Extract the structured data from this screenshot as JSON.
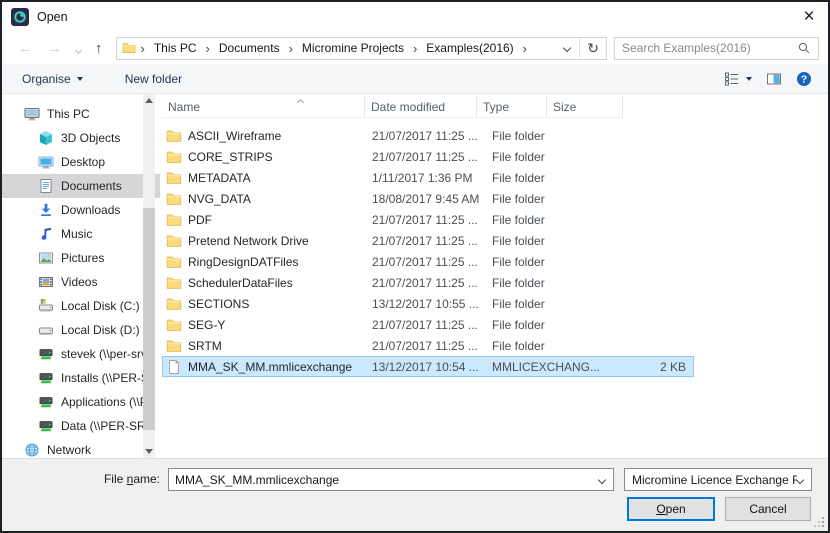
{
  "window": {
    "title": "Open"
  },
  "icons": {
    "app": "micromine-logo",
    "back": "←",
    "forward": "→",
    "up": "↑",
    "refresh": "↻",
    "close": "×"
  },
  "nav": {
    "breadcrumb": [
      "This PC",
      "Documents",
      "Micromine Projects",
      "Examples(2016)"
    ],
    "crumb_separator": "›",
    "search_placeholder": "Search Examples(2016)"
  },
  "toolbar": {
    "organise_label": "Organise",
    "new_folder_label": "New folder"
  },
  "sidebar": {
    "items": [
      {
        "label": "This PC",
        "icon": "pc",
        "indent": 0
      },
      {
        "label": "3D Objects",
        "icon": "cube",
        "indent": 1
      },
      {
        "label": "Desktop",
        "icon": "desktop",
        "indent": 1
      },
      {
        "label": "Documents",
        "icon": "document",
        "indent": 1,
        "selected": true
      },
      {
        "label": "Downloads",
        "icon": "download",
        "indent": 1
      },
      {
        "label": "Music",
        "icon": "music",
        "indent": 1
      },
      {
        "label": "Pictures",
        "icon": "pictures",
        "indent": 1
      },
      {
        "label": "Videos",
        "icon": "videos",
        "indent": 1
      },
      {
        "label": "Local Disk (C:)",
        "icon": "diskwin",
        "indent": 1
      },
      {
        "label": "Local Disk (D:)",
        "icon": "disk",
        "indent": 1
      },
      {
        "label": "stevek (\\\\per-srv",
        "icon": "netdrive",
        "indent": 1
      },
      {
        "label": "Installs (\\\\PER-S",
        "icon": "netdrive",
        "indent": 1
      },
      {
        "label": "Applications (\\\\P",
        "icon": "netdrive",
        "indent": 1
      },
      {
        "label": "Data (\\\\PER-SRV",
        "icon": "netdrive",
        "indent": 1
      },
      {
        "label": "Network",
        "icon": "globe",
        "indent": 0
      }
    ]
  },
  "list": {
    "columns": [
      "Name",
      "Date modified",
      "Type",
      "Size"
    ],
    "rows": [
      {
        "name": "ASCII_Wireframe",
        "date": "21/07/2017 11:25 ...",
        "type": "File folder",
        "size": "",
        "icon": "folder"
      },
      {
        "name": "CORE_STRIPS",
        "date": "21/07/2017 11:25 ...",
        "type": "File folder",
        "size": "",
        "icon": "folder"
      },
      {
        "name": "METADATA",
        "date": "1/11/2017 1:36 PM",
        "type": "File folder",
        "size": "",
        "icon": "folder"
      },
      {
        "name": "NVG_DATA",
        "date": "18/08/2017 9:45 AM",
        "type": "File folder",
        "size": "",
        "icon": "folder"
      },
      {
        "name": "PDF",
        "date": "21/07/2017 11:25 ...",
        "type": "File folder",
        "size": "",
        "icon": "folder"
      },
      {
        "name": "Pretend Network Drive",
        "date": "21/07/2017 11:25 ...",
        "type": "File folder",
        "size": "",
        "icon": "folder"
      },
      {
        "name": "RingDesignDATFiles",
        "date": "21/07/2017 11:25 ...",
        "type": "File folder",
        "size": "",
        "icon": "folder"
      },
      {
        "name": "SchedulerDataFiles",
        "date": "21/07/2017 11:25 ...",
        "type": "File folder",
        "size": "",
        "icon": "folder"
      },
      {
        "name": "SECTIONS",
        "date": "13/12/2017 10:55 ...",
        "type": "File folder",
        "size": "",
        "icon": "folder"
      },
      {
        "name": "SEG-Y",
        "date": "21/07/2017 11:25 ...",
        "type": "File folder",
        "size": "",
        "icon": "folder"
      },
      {
        "name": "SRTM",
        "date": "21/07/2017 11:25 ...",
        "type": "File folder",
        "size": "",
        "icon": "folder"
      },
      {
        "name": "MMA_SK_MM.mmlicexchange",
        "date": "13/12/2017 10:54 ...",
        "type": "MMLICEXCHANG...",
        "size": "2 KB",
        "icon": "file",
        "selected": true
      }
    ]
  },
  "footer": {
    "file_name_label_pre": "File ",
    "file_name_label_mn": "n",
    "file_name_label_post": "ame:",
    "file_name_value": "MMA_SK_MM.mmlicexchange",
    "file_type_value": "Micromine Licence Exchange F",
    "open_mn": "O",
    "open_post": "pen",
    "cancel_label": "Cancel"
  },
  "colors": {
    "accent": "#0078d7",
    "selection_fill": "#cce8ff",
    "selection_border": "#8ec7f2",
    "sidebar_selected": "#d6d6d6",
    "toolbar_text": "#25365a",
    "folder": "#fbdb7c"
  }
}
